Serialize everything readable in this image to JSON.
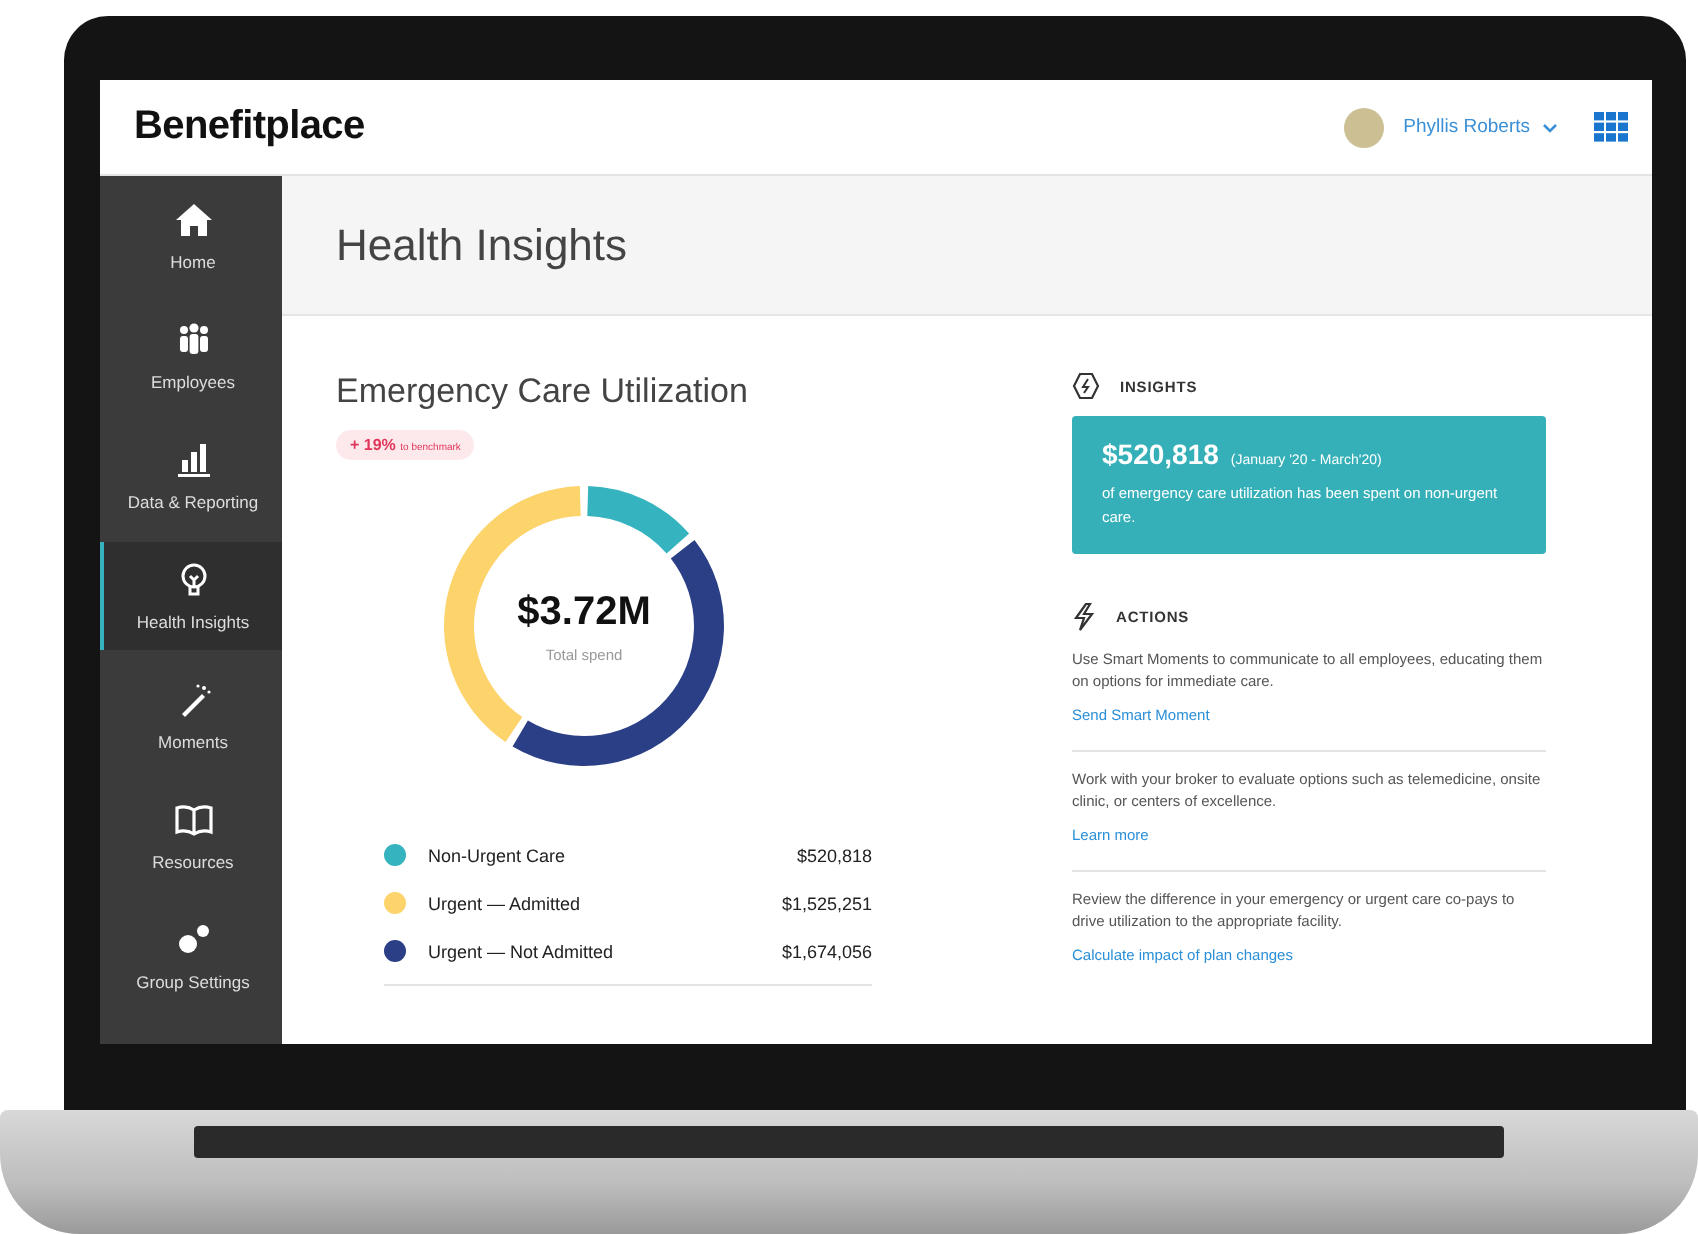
{
  "header": {
    "logo": "Benefitplace",
    "user_name": "Phyllis Roberts"
  },
  "sidebar": {
    "items": [
      {
        "label": "Home",
        "selected": false
      },
      {
        "label": "Employees",
        "selected": false
      },
      {
        "label": "Data & Reporting",
        "selected": false
      },
      {
        "label": "Health Insights",
        "selected": true
      },
      {
        "label": "Moments",
        "selected": false
      },
      {
        "label": "Resources",
        "selected": false
      },
      {
        "label": "Group Settings",
        "selected": false
      }
    ]
  },
  "page_title": "Health Insights",
  "utilization": {
    "title": "Emergency Care Utilization",
    "badge_value": "+ 19%",
    "badge_note": "to benchmark",
    "total": "$3.72M",
    "total_label": "Total spend",
    "chart_data": {
      "type": "donut",
      "categories": [
        "Non-Urgent Care",
        "Urgent — Admitted",
        "Urgent — Not Admitted"
      ],
      "series": [
        {
          "values": [
            14,
            41,
            45
          ]
        }
      ]
    },
    "legend": [
      {
        "amount": "$520,818",
        "color": "#35b4c0"
      },
      {
        "amount": "$1,525,251",
        "color": "#fdd36b"
      },
      {
        "amount": "$1,674,056",
        "color": "#2b3f86"
      }
    ]
  },
  "insights": {
    "heading": "INSIGHTS",
    "amount": "$520,818",
    "period": "(January '20 - March'20)",
    "text": "of emergency care utilization has been spent on non-urgent care."
  },
  "actions": {
    "heading": "ACTIONS",
    "items": [
      {
        "text": "Use Smart Moments to communicate to all employees, educating them on options for immediate care.",
        "link": "Send Smart Moment"
      },
      {
        "text": "Work with your broker to evaluate options such as telemedicine, onsite clinic, or centers of excellence.",
        "link": "Learn more"
      },
      {
        "text": "Review the difference in your emergency or urgent care co-pays to drive utilization to the appropriate facility.",
        "link": "Calculate impact of plan changes"
      }
    ]
  }
}
